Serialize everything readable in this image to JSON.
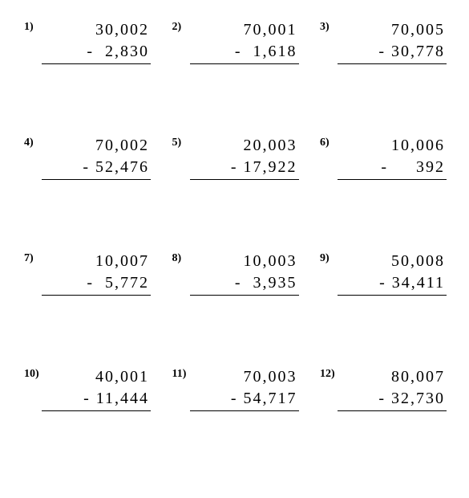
{
  "problems": [
    {
      "num": "1)",
      "top": "30,002",
      "op": "-",
      "bottom": "2,830"
    },
    {
      "num": "2)",
      "top": "70,001",
      "op": "-",
      "bottom": "1,618"
    },
    {
      "num": "3)",
      "top": "70,005",
      "op": "-",
      "bottom": "30,778"
    },
    {
      "num": "4)",
      "top": "70,002",
      "op": "-",
      "bottom": "52,476"
    },
    {
      "num": "5)",
      "top": "20,003",
      "op": "-",
      "bottom": "17,922"
    },
    {
      "num": "6)",
      "top": "10,006",
      "op": "-",
      "bottom": "392"
    },
    {
      "num": "7)",
      "top": "10,007",
      "op": "-",
      "bottom": "5,772"
    },
    {
      "num": "8)",
      "top": "10,003",
      "op": "-",
      "bottom": "3,935"
    },
    {
      "num": "9)",
      "top": "50,008",
      "op": "-",
      "bottom": "34,411"
    },
    {
      "num": "10)",
      "top": "40,001",
      "op": "-",
      "bottom": "11,444"
    },
    {
      "num": "11)",
      "top": "70,003",
      "op": "-",
      "bottom": "54,717"
    },
    {
      "num": "12)",
      "top": "80,007",
      "op": "-",
      "bottom": "32,730"
    }
  ]
}
